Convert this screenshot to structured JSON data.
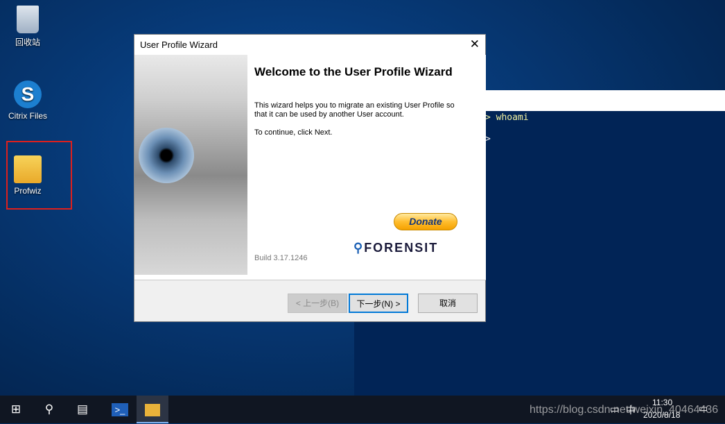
{
  "desktop": {
    "icons": [
      {
        "label": "回收站",
        "icon": "recycle-bin-icon"
      },
      {
        "label": "Citrix Files",
        "icon": "citrix-files-icon"
      },
      {
        "label": "Profwiz",
        "icon": "profwiz-icon"
      }
    ]
  },
  "powershell": {
    "lines": [
      "> whoami",
      ">"
    ]
  },
  "dialog": {
    "title": "User Profile Wizard",
    "heading": "Welcome to the User Profile Wizard",
    "paragraph1": "This wizard helps you to migrate an existing User Profile so that it can be used by another User account.",
    "paragraph2": "To continue, click Next.",
    "donate": "Donate",
    "build": "Build 3.17.1246",
    "logo": "FORENSIT",
    "back": "< 上一步(B)",
    "next": "下一步(N) >",
    "cancel": "取消"
  },
  "taskbar": {
    "time": "11:30",
    "date": "2020/8/18",
    "ime": "中",
    "watermark": "https://blog.csdn.net/weixin_40464436"
  }
}
